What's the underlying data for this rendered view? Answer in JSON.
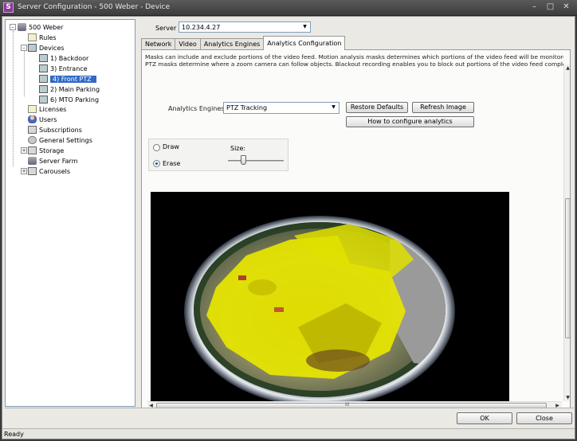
{
  "window": {
    "title": "Server Configuration - 500 Weber - Device",
    "app_icon_glyph": "S",
    "buttons": [
      "minimize",
      "maximize",
      "close"
    ]
  },
  "tree": {
    "root": "500 Weber",
    "items": [
      {
        "label": "Rules",
        "icon": "rules-icon"
      },
      {
        "label": "Devices",
        "icon": "devices-icon"
      },
      {
        "label": "1) Backdoor",
        "icon": "camera-icon"
      },
      {
        "label": "3) Entrance",
        "icon": "camera-icon"
      },
      {
        "label": "4) Front PTZ",
        "icon": "camera-icon",
        "selected": true
      },
      {
        "label": "2) Main Parking",
        "icon": "camera-icon"
      },
      {
        "label": "6) MTO Parking",
        "icon": "camera-icon"
      },
      {
        "label": "Licenses",
        "icon": "licenses-icon"
      },
      {
        "label": "Users",
        "icon": "users-icon"
      },
      {
        "label": "Subscriptions",
        "icon": "subscriptions-icon"
      },
      {
        "label": "General Settings",
        "icon": "gear-icon"
      },
      {
        "label": "Storage",
        "icon": "storage-icon"
      },
      {
        "label": "Server Farm",
        "icon": "server-farm-icon"
      },
      {
        "label": "Carousels",
        "icon": "carousels-icon"
      }
    ]
  },
  "server": {
    "label": "Server",
    "value": "10.234.4.27"
  },
  "tabs": [
    "Network",
    "Video",
    "Analytics Engines",
    "Analytics Configuration"
  ],
  "active_tab": "Analytics Configuration",
  "panel": {
    "description_line1": "Masks can include and exclude portions of the video feed.  Motion analysis masks determines which portions of the video feed will be monitored.",
    "description_line2": "PTZ masks determine where a zoom camera can follow objects.  Blackout recording enables you to block out portions of the video feed completely",
    "analytics_engines_label": "Analytics Engines",
    "analytics_engines_value": "PTZ Tracking",
    "restore_defaults": "Restore Defaults",
    "refresh_image": "Refresh Image",
    "how_to_configure": "How to configure analytics",
    "draw_label": "Draw",
    "erase_label": "Erase",
    "selected_mode": "Erase",
    "size_label": "Size:",
    "size_level": 0.3
  },
  "footer": {
    "ok": "OK",
    "close": "Close",
    "status": "Ready",
    "hscroll_grip": "III"
  },
  "colors": {
    "selection": "#3169c6",
    "mask_yellow": "#e7e600",
    "titlebar": "#4a4a4a"
  }
}
